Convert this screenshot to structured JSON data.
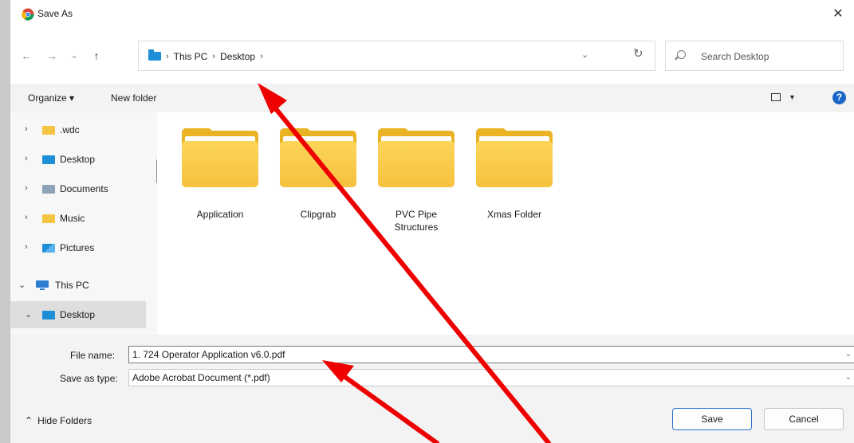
{
  "window": {
    "title": "Save As",
    "close_glyph": "✕"
  },
  "nav": {
    "back_glyph": "←",
    "forward_glyph": "→",
    "recent_glyph": "⌄",
    "up_glyph": "↑",
    "breadcrumbs": [
      "This PC",
      "Desktop"
    ],
    "crumb_sep": "›",
    "dropdown_glyph": "⌄",
    "refresh_glyph": "↻",
    "search_placeholder": "Search Desktop"
  },
  "toolbar": {
    "organize_label": "Organize ▾",
    "new_folder_label": "New folder",
    "view_dropdown_glyph": "▼",
    "help_glyph": "?"
  },
  "sidebar": {
    "items": [
      {
        "label": ".wdc",
        "chevron": "›"
      },
      {
        "label": "Desktop",
        "chevron": "›"
      },
      {
        "label": "Documents",
        "chevron": "›"
      },
      {
        "label": "Music",
        "chevron": "›"
      },
      {
        "label": "Pictures",
        "chevron": "›"
      },
      {
        "label": "This PC",
        "chevron": "⌄"
      },
      {
        "label": "Desktop",
        "chevron": "⌄",
        "selected": true
      }
    ]
  },
  "folders": [
    {
      "line1": "Application",
      "line2": ""
    },
    {
      "line1": "Clipgrab",
      "line2": ""
    },
    {
      "line1": "PVC Pipe",
      "line2": "Structures"
    },
    {
      "line1": "Xmas Folder",
      "line2": ""
    }
  ],
  "fields": {
    "file_name_label": "File name:",
    "file_name_value": "1. 724 Operator Application v6.0.pdf",
    "save_type_label": "Save as type:",
    "save_type_value": "Adobe Acrobat Document (*.pdf)",
    "dropdown_glyph": "⌄"
  },
  "footer": {
    "hide_folders_glyph": "⌃",
    "hide_folders_label": "Hide Folders",
    "save_label": "Save",
    "cancel_label": "Cancel"
  },
  "colors": {
    "annotation_arrow": "#ee0000",
    "folder_yellow": "#f6c23f",
    "accent_blue": "#2b6fd1"
  }
}
